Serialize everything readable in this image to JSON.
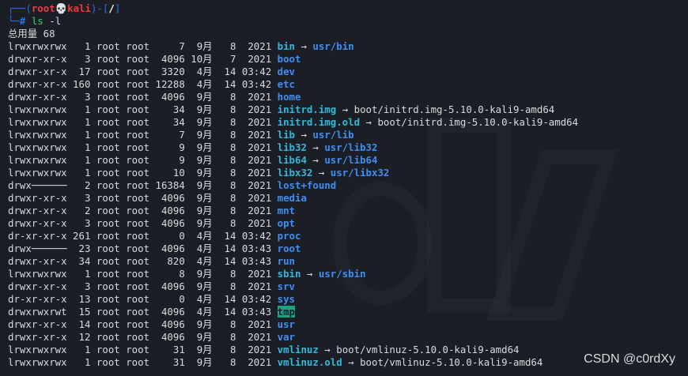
{
  "prompt": {
    "frame_top": "┌──(",
    "user": "root",
    "skull": "💀",
    "host": "kali",
    "frame_mid": ")-[",
    "cwd": "/",
    "frame_end": "]",
    "frame_bottom": "└─",
    "hash": "#",
    "command": "ls",
    "command_arg": " -l"
  },
  "total_line": "总用量 68",
  "entries": [
    {
      "meta": "lrwxrwxrwx   1 root root     7  9月   8  2021 ",
      "name": "bin",
      "kind": "link",
      "target": "usr/bin",
      "target_kind": "dir"
    },
    {
      "meta": "drwxr-xr-x   3 root root  4096 10月   7  2021 ",
      "name": "boot",
      "kind": "dir"
    },
    {
      "meta": "drwxr-xr-x  17 root root  3320  4月  14 03:42 ",
      "name": "dev",
      "kind": "dir"
    },
    {
      "meta": "drwxr-xr-x 160 root root 12288  4月  14 03:42 ",
      "name": "etc",
      "kind": "dir"
    },
    {
      "meta": "drwxr-xr-x   3 root root  4096  9月   8  2021 ",
      "name": "home",
      "kind": "dir"
    },
    {
      "meta": "lrwxrwxrwx   1 root root    34  9月   8  2021 ",
      "name": "initrd.img",
      "kind": "link",
      "target": "boot/initrd.img-5.10.0-kali9-amd64",
      "target_kind": "plain"
    },
    {
      "meta": "lrwxrwxrwx   1 root root    34  9月   8  2021 ",
      "name": "initrd.img.old",
      "kind": "link",
      "target": "boot/initrd.img-5.10.0-kali9-amd64",
      "target_kind": "plain"
    },
    {
      "meta": "lrwxrwxrwx   1 root root     7  9月   8  2021 ",
      "name": "lib",
      "kind": "link",
      "target": "usr/lib",
      "target_kind": "dir"
    },
    {
      "meta": "lrwxrwxrwx   1 root root     9  9月   8  2021 ",
      "name": "lib32",
      "kind": "link",
      "target": "usr/lib32",
      "target_kind": "dir"
    },
    {
      "meta": "lrwxrwxrwx   1 root root     9  9月   8  2021 ",
      "name": "lib64",
      "kind": "link",
      "target": "usr/lib64",
      "target_kind": "dir"
    },
    {
      "meta": "lrwxrwxrwx   1 root root    10  9月   8  2021 ",
      "name": "libx32",
      "kind": "link",
      "target": "usr/libx32",
      "target_kind": "dir"
    },
    {
      "meta": "drwx──────   2 root root 16384  9月   8  2021 ",
      "name": "lost+found",
      "kind": "dir"
    },
    {
      "meta": "drwxr-xr-x   3 root root  4096  9月   8  2021 ",
      "name": "media",
      "kind": "dir"
    },
    {
      "meta": "drwxr-xr-x   2 root root  4096  9月   8  2021 ",
      "name": "mnt",
      "kind": "dir"
    },
    {
      "meta": "drwxr-xr-x   3 root root  4096  9月   8  2021 ",
      "name": "opt",
      "kind": "dir"
    },
    {
      "meta": "dr-xr-xr-x 261 root root     0  4月  14 03:42 ",
      "name": "proc",
      "kind": "dir"
    },
    {
      "meta": "drwx──────  23 root root  4096  4月  14 03:43 ",
      "name": "root",
      "kind": "dir"
    },
    {
      "meta": "drwxr-xr-x  34 root root   820  4月  14 03:43 ",
      "name": "run",
      "kind": "dir"
    },
    {
      "meta": "lrwxrwxrwx   1 root root     8  9月   8  2021 ",
      "name": "sbin",
      "kind": "link",
      "target": "usr/sbin",
      "target_kind": "dir"
    },
    {
      "meta": "drwxr-xr-x   3 root root  4096  9月   8  2021 ",
      "name": "srv",
      "kind": "dir"
    },
    {
      "meta": "dr-xr-xr-x  13 root root     0  4月  14 03:42 ",
      "name": "sys",
      "kind": "dir"
    },
    {
      "meta": "drwxrwxrwt  15 root root  4096  4月  14 03:43 ",
      "name": "tmp",
      "kind": "sticky"
    },
    {
      "meta": "drwxr-xr-x  14 root root  4096  9月   8  2021 ",
      "name": "usr",
      "kind": "dir"
    },
    {
      "meta": "drwxr-xr-x  12 root root  4096  9月   8  2021 ",
      "name": "var",
      "kind": "dir"
    },
    {
      "meta": "lrwxrwxrwx   1 root root    31  9月   8  2021 ",
      "name": "vmlinuz",
      "kind": "link",
      "target": "boot/vmlinuz-5.10.0-kali9-amd64",
      "target_kind": "plain"
    },
    {
      "meta": "lrwxrwxrwx   1 root root    31  9月   8  2021 ",
      "name": "vmlinuz.old",
      "kind": "link",
      "target": "boot/vmlinuz-5.10.0-kali9-amd64",
      "target_kind": "plain"
    }
  ],
  "arrow": " → ",
  "watermark": "CSDN @c0rdXy",
  "colors": {
    "background": "#1b1e25",
    "prompt_frame": "#2f6fdb",
    "prompt_user": "#ee3b3b",
    "command": "#3fd16b",
    "directory": "#3f8ef0",
    "symlink": "#35b7d9",
    "sticky_bg": "#1fa07e"
  }
}
